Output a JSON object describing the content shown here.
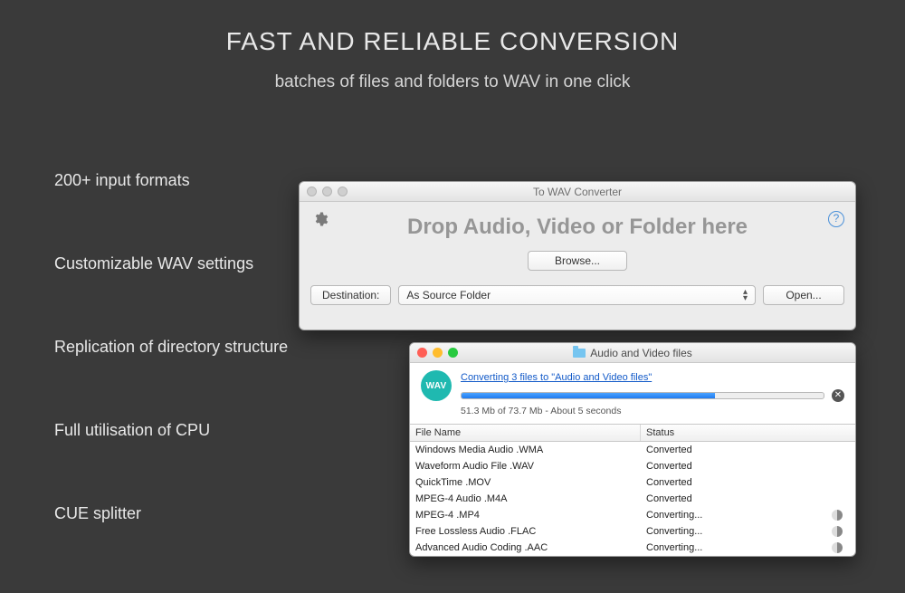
{
  "headline": "FAST AND RELIABLE CONVERSION",
  "subheadline": "batches of files and folders to WAV in one click",
  "features": [
    "200+ input formats",
    "Customizable WAV settings",
    "Replication of directory structure",
    "Full utilisation of CPU",
    "CUE splitter"
  ],
  "win1": {
    "title": "To WAV Converter",
    "drop_text": "Drop Audio, Video or Folder here",
    "browse": "Browse...",
    "destination_label": "Destination:",
    "destination_value": "As Source Folder",
    "open": "Open...",
    "help_glyph": "?"
  },
  "win2": {
    "title": "Audio and Video files",
    "wav_badge": "WAV",
    "link_text": "Converting 3 files to \"Audio and Video files\"",
    "progress_pct": 70,
    "progress_text": "51.3 Mb of 73.7 Mb - About 5 seconds",
    "columns": {
      "name": "File Name",
      "status": "Status"
    },
    "rows": [
      {
        "name": "Windows Media Audio .WMA",
        "status": "Converted",
        "busy": false
      },
      {
        "name": "Waveform Audio File .WAV",
        "status": "Converted",
        "busy": false
      },
      {
        "name": "QuickTime .MOV",
        "status": "Converted",
        "busy": false
      },
      {
        "name": "MPEG-4 Audio .M4A",
        "status": "Converted",
        "busy": false
      },
      {
        "name": "MPEG-4 .MP4",
        "status": "Converting...",
        "busy": true
      },
      {
        "name": "Free Lossless Audio .FLAC",
        "status": "Converting...",
        "busy": true
      },
      {
        "name": "Advanced Audio Coding .AAC",
        "status": "Converting...",
        "busy": true
      }
    ]
  }
}
